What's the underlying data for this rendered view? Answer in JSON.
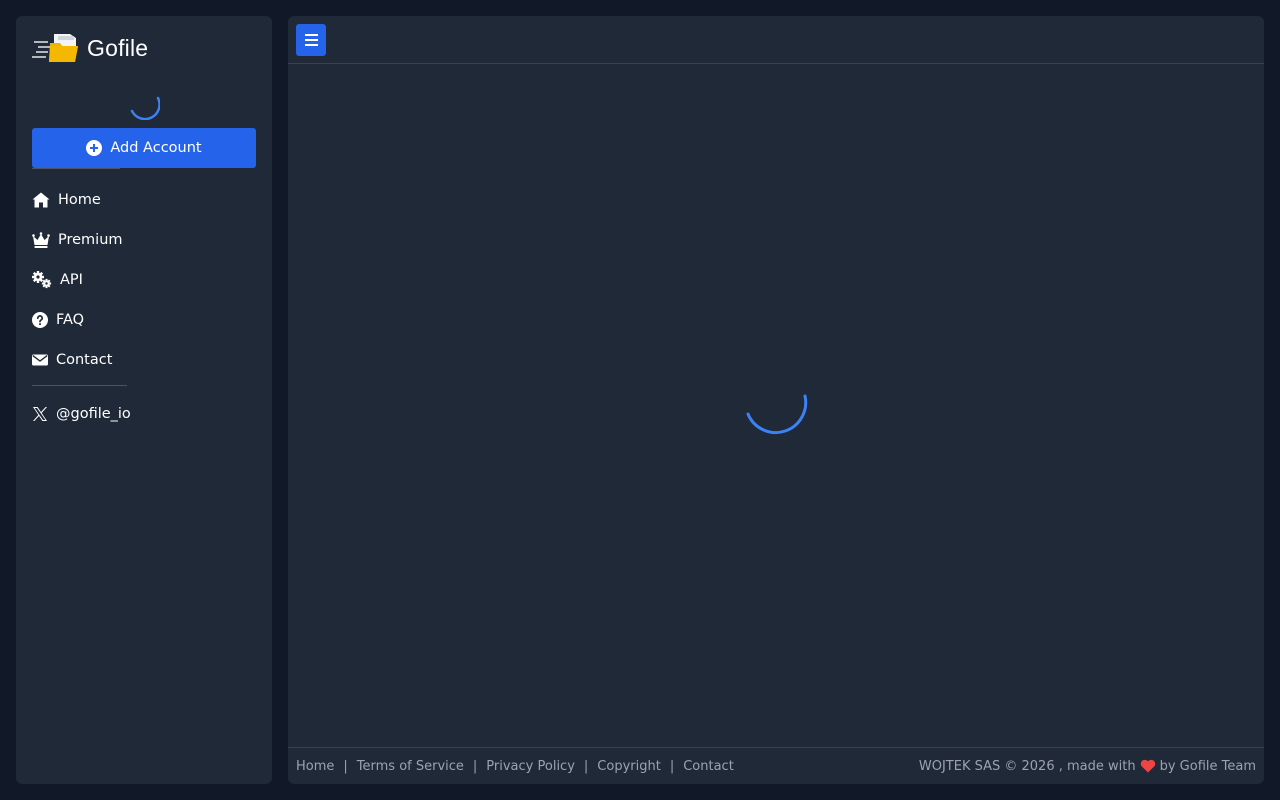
{
  "sidebar": {
    "logo": {
      "text": "Gofile",
      "icon": "folder-speed-icon"
    },
    "add_account_label": "Add Account",
    "nav": [
      {
        "label": "Home",
        "icon": "home-icon"
      },
      {
        "label": "Premium",
        "icon": "crown-icon"
      },
      {
        "label": "API",
        "icon": "gears-icon"
      },
      {
        "label": "FAQ",
        "icon": "question-circle-icon"
      },
      {
        "label": "Contact",
        "icon": "envelope-icon"
      }
    ],
    "social": {
      "label": "@gofile_io",
      "icon": "x-logo-icon"
    }
  },
  "footer": {
    "links": [
      "Home",
      "Terms of Service",
      "Privacy Policy",
      "Copyright",
      "Contact"
    ],
    "separator": "|",
    "credit_prefix": "WOJTEK SAS © 2026 , made with",
    "credit_suffix": "by Gofile Team"
  },
  "colors": {
    "background": "#111827",
    "panel": "#1f2937",
    "accent": "#2563eb",
    "muted_text": "#9ca3af",
    "logo_yellow": "#eab308"
  }
}
